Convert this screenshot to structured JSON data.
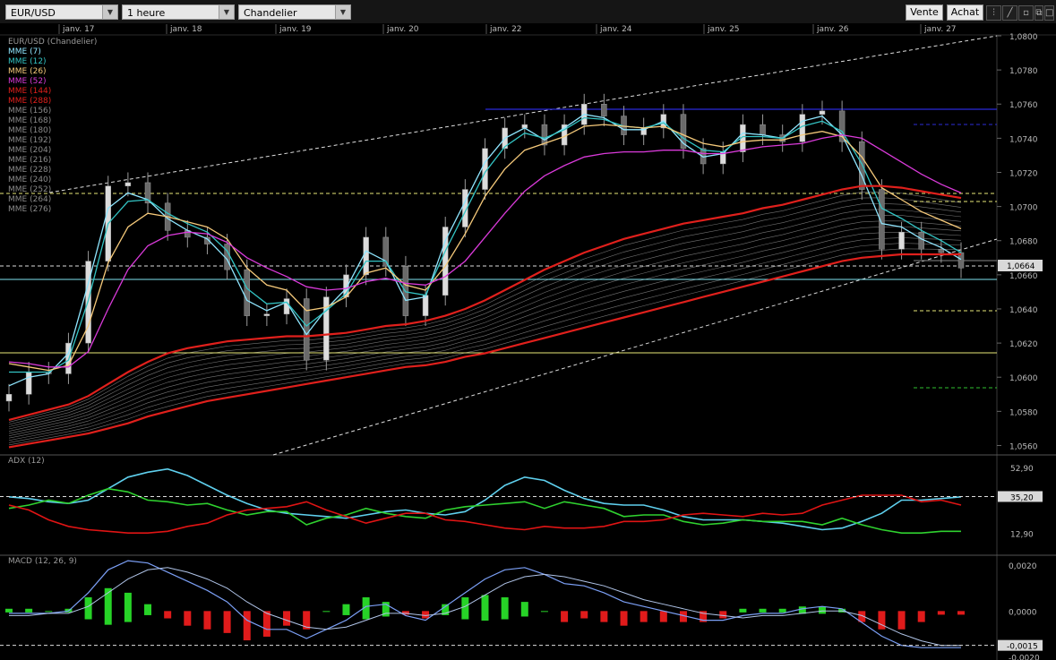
{
  "toolbar": {
    "symbol": "EUR/USD",
    "interval": "1 heure",
    "chart_type": "Chandelier",
    "sell_label": "Vente",
    "buy_label": "Achat",
    "icons": [
      "candles-icon",
      "draw-line-icon",
      "zoom-icon",
      "restore-window-icon",
      "maximize-icon"
    ]
  },
  "colors": {
    "ema7": "#8fe6ff",
    "ema12": "#33c4c4",
    "ema26": "#f5c97a",
    "ema52": "#d93ad9",
    "ema144": "#e0201c",
    "ema288": "#e0201c",
    "ribbon": "#9a9a9a",
    "adx": "#5fd0ee",
    "di_plus": "#2fd12f",
    "di_minus": "#e01414",
    "macd_line": "#7b9ff5",
    "signal_line": "#b0c4e8",
    "hist_up": "#27d327",
    "hist_down": "#e01b1b",
    "support_blue": "#2b2bd9",
    "cyan_level": "#7fe3f0",
    "yellow_level": "#e8e878",
    "green_level": "#2fbf2f"
  },
  "chart_data": [
    {
      "type": "line",
      "panel": "price",
      "title": "EUR/USD (Chandelier)",
      "x": [
        "janv. 17",
        "janv. 18",
        "janv. 19",
        "janv. 20",
        "janv. 22",
        "janv. 24",
        "janv. 25",
        "janv. 26",
        "janv. 27"
      ],
      "y_ticks": [
        "1,0800",
        "1,0780",
        "1,0760",
        "1,0740",
        "1,0720",
        "1,0700",
        "1,0680",
        "1,0660",
        "1,0640",
        "1,0620",
        "1,0600",
        "1,0580",
        "1,0560"
      ],
      "ylim": [
        1.0555,
        1.08
      ],
      "current_price": "1,0664",
      "legend": [
        "MME (7)",
        "MME (12)",
        "MME (26)",
        "MME (52)",
        "MME (144)",
        "MME (288)",
        "MME (156)",
        "MME (168)",
        "MME (180)",
        "MME (192)",
        "MME (204)",
        "MME (216)",
        "MME (228)",
        "MME (240)",
        "MME (252)",
        "MME (264)",
        "MME (276)"
      ],
      "series": [
        {
          "name": "EUR/USD",
          "values": [
            1.059,
            1.0603,
            1.0602,
            1.062,
            1.0668,
            1.0712,
            1.0714,
            1.0702,
            1.0686,
            1.0682,
            1.0678,
            1.0663,
            1.0636,
            1.0637,
            1.0646,
            1.061,
            1.0647,
            1.066,
            1.0682,
            1.0665,
            1.0636,
            1.0648,
            1.0688,
            1.071,
            1.0734,
            1.0746,
            1.0748,
            1.0736,
            1.0748,
            1.076,
            1.0753,
            1.0742,
            1.0746,
            1.0754,
            1.0734,
            1.0725,
            1.0732,
            1.0748,
            1.0742,
            1.0738,
            1.0754,
            1.0756,
            1.0738,
            1.071,
            1.0675,
            1.0685,
            1.0675,
            1.0673,
            1.0664
          ]
        },
        {
          "name": "MME (7)",
          "values": [
            1.0595,
            1.06,
            1.0602,
            1.0614,
            1.0655,
            1.0699,
            1.0708,
            1.0704,
            1.0693,
            1.0686,
            1.0681,
            1.0669,
            1.0645,
            1.0639,
            1.0644,
            1.0625,
            1.064,
            1.0652,
            1.0674,
            1.0668,
            1.0645,
            1.0647,
            1.068,
            1.0703,
            1.0726,
            1.074,
            1.0746,
            1.0739,
            1.0746,
            1.0754,
            1.0752,
            1.0745,
            1.0745,
            1.075,
            1.0737,
            1.0729,
            1.0731,
            1.0743,
            1.0742,
            1.074,
            1.075,
            1.0753,
            1.0742,
            1.0718,
            1.069,
            1.0688,
            1.0681,
            1.0676,
            1.0669
          ]
        },
        {
          "name": "MME (12)",
          "values": [
            1.0603,
            1.0603,
            1.0603,
            1.061,
            1.0645,
            1.069,
            1.0703,
            1.0704,
            1.0696,
            1.069,
            1.0685,
            1.0674,
            1.0652,
            1.0643,
            1.0644,
            1.063,
            1.0639,
            1.0649,
            1.0668,
            1.0668,
            1.065,
            1.0648,
            1.0674,
            1.0697,
            1.072,
            1.0735,
            1.0743,
            1.074,
            1.0745,
            1.0752,
            1.0751,
            1.0747,
            1.0746,
            1.0749,
            1.074,
            1.0733,
            1.0732,
            1.0741,
            1.0741,
            1.074,
            1.0747,
            1.075,
            1.0744,
            1.0725,
            1.0699,
            1.0693,
            1.0686,
            1.068,
            1.0673
          ]
        },
        {
          "name": "MME (26)",
          "values": [
            1.0608,
            1.0606,
            1.0604,
            1.0607,
            1.063,
            1.0667,
            1.0688,
            1.0696,
            1.0694,
            1.0691,
            1.0688,
            1.0681,
            1.0664,
            1.0654,
            1.0651,
            1.0639,
            1.0641,
            1.0647,
            1.0661,
            1.0664,
            1.0654,
            1.0651,
            1.0665,
            1.0684,
            1.0706,
            1.0722,
            1.0733,
            1.0737,
            1.0741,
            1.0747,
            1.0748,
            1.0747,
            1.0746,
            1.0747,
            1.0742,
            1.0737,
            1.0735,
            1.0738,
            1.0739,
            1.0739,
            1.0742,
            1.0744,
            1.0741,
            1.0729,
            1.0711,
            1.0704,
            1.0697,
            1.0692,
            1.0687
          ]
        },
        {
          "name": "MME (52)",
          "values": [
            1.0609,
            1.0608,
            1.0606,
            1.0606,
            1.0615,
            1.064,
            1.0663,
            1.0677,
            1.0683,
            1.0685,
            1.0684,
            1.0679,
            1.067,
            1.0664,
            1.0659,
            1.0653,
            1.0651,
            1.0652,
            1.0656,
            1.0658,
            1.0655,
            1.0654,
            1.0659,
            1.0668,
            1.0682,
            1.0696,
            1.0709,
            1.0718,
            1.0724,
            1.0729,
            1.0731,
            1.0732,
            1.0732,
            1.0733,
            1.0733,
            1.0731,
            1.0731,
            1.0733,
            1.0735,
            1.0736,
            1.0737,
            1.074,
            1.0742,
            1.074,
            1.0733,
            1.0726,
            1.0719,
            1.0713,
            1.0708
          ]
        },
        {
          "name": "MME (144)",
          "values": [
            1.0575,
            1.0578,
            1.0581,
            1.0584,
            1.0589,
            1.0596,
            1.0603,
            1.0609,
            1.0614,
            1.0617,
            1.0619,
            1.0621,
            1.0622,
            1.0623,
            1.0624,
            1.0624,
            1.0625,
            1.0626,
            1.0628,
            1.063,
            1.0631,
            1.0633,
            1.0636,
            1.064,
            1.0645,
            1.0651,
            1.0657,
            1.0663,
            1.0668,
            1.0673,
            1.0677,
            1.0681,
            1.0684,
            1.0687,
            1.069,
            1.0692,
            1.0694,
            1.0696,
            1.0699,
            1.0701,
            1.0704,
            1.0707,
            1.071,
            1.0712,
            1.0712,
            1.0711,
            1.0709,
            1.0707,
            1.0705
          ]
        },
        {
          "name": "MME (288)",
          "values": [
            1.0559,
            1.0561,
            1.0563,
            1.0565,
            1.0567,
            1.057,
            1.0573,
            1.0577,
            1.058,
            1.0583,
            1.0586,
            1.0588,
            1.059,
            1.0592,
            1.0594,
            1.0596,
            1.0598,
            1.06,
            1.0602,
            1.0604,
            1.0606,
            1.0607,
            1.0609,
            1.0612,
            1.0614,
            1.0617,
            1.062,
            1.0623,
            1.0626,
            1.0629,
            1.0632,
            1.0635,
            1.0638,
            1.0641,
            1.0644,
            1.0647,
            1.065,
            1.0653,
            1.0656,
            1.0659,
            1.0662,
            1.0665,
            1.0668,
            1.067,
            1.0671,
            1.0672,
            1.0672,
            1.0672,
            1.0672
          ]
        }
      ]
    },
    {
      "type": "line",
      "panel": "adx",
      "title": "ADX (12)",
      "y_ticks": [
        "52,90",
        "35,20",
        "12,90"
      ],
      "ylim": [
        0,
        60
      ],
      "series": [
        {
          "name": "ADX",
          "values": [
            35,
            34,
            32,
            31,
            33,
            40,
            47,
            50,
            52,
            48,
            42,
            36,
            31,
            27,
            25,
            24,
            23,
            22,
            24,
            26,
            27,
            25,
            24,
            26,
            33,
            42,
            47,
            45,
            39,
            34,
            31,
            30,
            30,
            27,
            23,
            21,
            21,
            21,
            20,
            19,
            17,
            15,
            16,
            20,
            25,
            33,
            33,
            34,
            35
          ]
        },
        {
          "name": "DI+",
          "values": [
            28,
            30,
            33,
            31,
            36,
            40,
            38,
            33,
            32,
            30,
            31,
            27,
            24,
            26,
            26,
            18,
            22,
            24,
            28,
            25,
            23,
            22,
            27,
            29,
            30,
            31,
            32,
            28,
            32,
            30,
            28,
            23,
            24,
            24,
            20,
            18,
            19,
            21,
            20,
            20,
            20,
            18,
            22,
            18,
            15,
            13,
            13,
            14,
            14
          ]
        },
        {
          "name": "DI-",
          "values": [
            30,
            27,
            21,
            17,
            15,
            14,
            13,
            13,
            14,
            17,
            19,
            24,
            27,
            28,
            29,
            32,
            27,
            23,
            19,
            22,
            25,
            25,
            21,
            20,
            18,
            16,
            15,
            17,
            16,
            16,
            17,
            20,
            20,
            21,
            24,
            25,
            24,
            23,
            25,
            24,
            25,
            30,
            33,
            36,
            36,
            36,
            32,
            33,
            30
          ]
        }
      ]
    },
    {
      "type": "bar",
      "panel": "macd",
      "title": "MACD (12, 26, 9)",
      "y_ticks": [
        "0,0020",
        "0,0000",
        "-0,0015",
        "-0,0020"
      ],
      "ylim": [
        -0.0021,
        0.0024
      ],
      "series": [
        {
          "name": "MACD",
          "values": [
            -0.0001,
            -0.0001,
            -0.0001,
            0.0,
            0.0008,
            0.0018,
            0.0022,
            0.0021,
            0.0017,
            0.0013,
            0.0009,
            0.0004,
            -0.0004,
            -0.0008,
            -0.0008,
            -0.0012,
            -0.0008,
            -0.0004,
            0.0002,
            0.0003,
            -0.0002,
            -0.0004,
            0.0002,
            0.0008,
            0.0014,
            0.0018,
            0.0019,
            0.0016,
            0.0012,
            0.0011,
            0.0008,
            0.0004,
            0.0002,
            0.0,
            -0.0002,
            -0.0004,
            -0.0004,
            -0.0002,
            -0.0001,
            -0.0001,
            0.0001,
            0.0002,
            0.0001,
            -0.0005,
            -0.0011,
            -0.0015,
            -0.0016,
            -0.0016,
            -0.0016
          ]
        },
        {
          "name": "Signal",
          "values": [
            -0.0002,
            -0.0002,
            -0.0001,
            -0.0001,
            0.0002,
            0.0008,
            0.0014,
            0.0018,
            0.0019,
            0.0017,
            0.0014,
            0.001,
            0.0004,
            -0.0001,
            -0.0004,
            -0.0007,
            -0.0008,
            -0.0007,
            -0.0004,
            -0.0001,
            -0.0001,
            -0.0002,
            -0.0001,
            0.0002,
            0.0007,
            0.0012,
            0.0015,
            0.0016,
            0.0015,
            0.0013,
            0.0011,
            0.0008,
            0.0005,
            0.0003,
            0.0001,
            -0.0001,
            -0.0002,
            -0.0003,
            -0.0002,
            -0.0002,
            -0.0001,
            0.0,
            0.0,
            -0.0002,
            -0.0006,
            -0.001,
            -0.0013,
            -0.0015,
            -0.0015
          ]
        }
      ]
    }
  ]
}
